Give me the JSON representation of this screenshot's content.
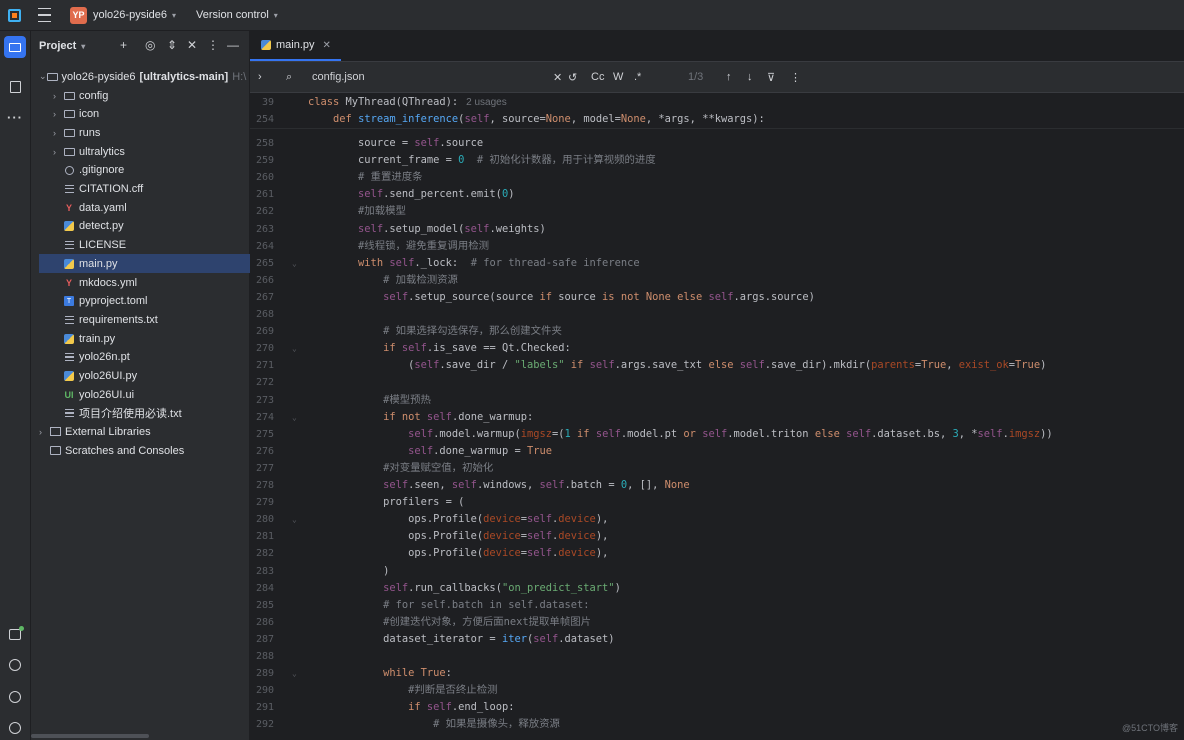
{
  "titlebar": {
    "project_badge": "YP",
    "project_name": "yolo26-pyside6",
    "vcs_label": "Version control"
  },
  "project_panel": {
    "title": "Project",
    "root": {
      "name": "yolo26-pyside6",
      "branch": "[ultralytics-main]",
      "path_hint": "H:\\"
    },
    "items": [
      {
        "name": "config",
        "type": "folder",
        "expandable": true
      },
      {
        "name": "icon",
        "type": "folder",
        "expandable": true
      },
      {
        "name": "runs",
        "type": "folder",
        "expandable": true
      },
      {
        "name": "ultralytics",
        "type": "folder",
        "expandable": true
      },
      {
        "name": ".gitignore",
        "type": "ignore"
      },
      {
        "name": "CITATION.cff",
        "type": "txt"
      },
      {
        "name": "data.yaml",
        "type": "yaml"
      },
      {
        "name": "detect.py",
        "type": "py"
      },
      {
        "name": "LICENSE",
        "type": "txt"
      },
      {
        "name": "main.py",
        "type": "py",
        "selected": true
      },
      {
        "name": "mkdocs.yml",
        "type": "yaml"
      },
      {
        "name": "pyproject.toml",
        "type": "toml"
      },
      {
        "name": "requirements.txt",
        "type": "txt"
      },
      {
        "name": "train.py",
        "type": "py"
      },
      {
        "name": "yolo26n.pt",
        "type": "txt"
      },
      {
        "name": "yolo26UI.py",
        "type": "py"
      },
      {
        "name": "yolo26UI.ui",
        "type": "ui"
      },
      {
        "name": "项目介绍使用必读.txt",
        "type": "txt"
      }
    ],
    "external_libraries": "External Libraries",
    "scratches": "Scratches and Consoles"
  },
  "editor": {
    "tab_label": "main.py",
    "find": {
      "query": "config.json",
      "match_count": "1/3",
      "opt_case": "Cc",
      "opt_word": "W",
      "opt_regex": ".*"
    },
    "sticky": [
      {
        "ln": "39",
        "code": "class MyThread(QThread):",
        "usages": "2 usages"
      },
      {
        "ln": "254",
        "code": "    def stream_inference(self, source=None, model=None, *args, **kwargs):"
      }
    ],
    "lines": [
      {
        "ln": "258",
        "code": "        source = self.source"
      },
      {
        "ln": "259",
        "code": "        current_frame = 0  # 初始化计数器，用于计算视频的进度"
      },
      {
        "ln": "260",
        "code": "        # 重置进度条"
      },
      {
        "ln": "261",
        "code": "        self.send_percent.emit(0)"
      },
      {
        "ln": "262",
        "code": "        #加载模型"
      },
      {
        "ln": "263",
        "code": "        self.setup_model(self.weights)"
      },
      {
        "ln": "264",
        "code": "        #线程锁，避免重复调用检测"
      },
      {
        "ln": "265",
        "code": "        with self._lock:  # for thread-safe inference"
      },
      {
        "ln": "266",
        "code": "            # 加载检测资源"
      },
      {
        "ln": "267",
        "code": "            self.setup_source(source if source is not None else self.args.source)"
      },
      {
        "ln": "268",
        "code": ""
      },
      {
        "ln": "269",
        "code": "            # 如果选择勾选保存，那么创建文件夹"
      },
      {
        "ln": "270",
        "code": "            if self.is_save == Qt.Checked:"
      },
      {
        "ln": "271",
        "code": "                (self.save_dir / \"labels\" if self.args.save_txt else self.save_dir).mkdir(parents=True, exist_ok=True)"
      },
      {
        "ln": "272",
        "code": ""
      },
      {
        "ln": "273",
        "code": "            #模型预热"
      },
      {
        "ln": "274",
        "code": "            if not self.done_warmup:"
      },
      {
        "ln": "275",
        "code": "                self.model.warmup(imgsz=(1 if self.model.pt or self.model.triton else self.dataset.bs, 3, *self.imgsz))"
      },
      {
        "ln": "276",
        "code": "                self.done_warmup = True"
      },
      {
        "ln": "277",
        "code": "            #对变量赋空值，初始化"
      },
      {
        "ln": "278",
        "code": "            self.seen, self.windows, self.batch = 0, [], None"
      },
      {
        "ln": "279",
        "code": "            profilers = ("
      },
      {
        "ln": "280",
        "code": "                ops.Profile(device=self.device),"
      },
      {
        "ln": "281",
        "code": "                ops.Profile(device=self.device),"
      },
      {
        "ln": "282",
        "code": "                ops.Profile(device=self.device),"
      },
      {
        "ln": "283",
        "code": "            )"
      },
      {
        "ln": "284",
        "code": "            self.run_callbacks(\"on_predict_start\")"
      },
      {
        "ln": "285",
        "code": "            # for self.batch in self.dataset:"
      },
      {
        "ln": "286",
        "code": "            #创建迭代对象，方便后面next提取单帧图片"
      },
      {
        "ln": "287",
        "code": "            dataset_iterator = iter(self.dataset)"
      },
      {
        "ln": "288",
        "code": ""
      },
      {
        "ln": "289",
        "code": "            while True:"
      },
      {
        "ln": "290",
        "code": "                #判断是否终止检测"
      },
      {
        "ln": "291",
        "code": "                if self.end_loop:"
      },
      {
        "ln": "292",
        "code": "                    # 如果是摄像头，释放资源"
      }
    ]
  },
  "watermark": "@51CTO博客"
}
